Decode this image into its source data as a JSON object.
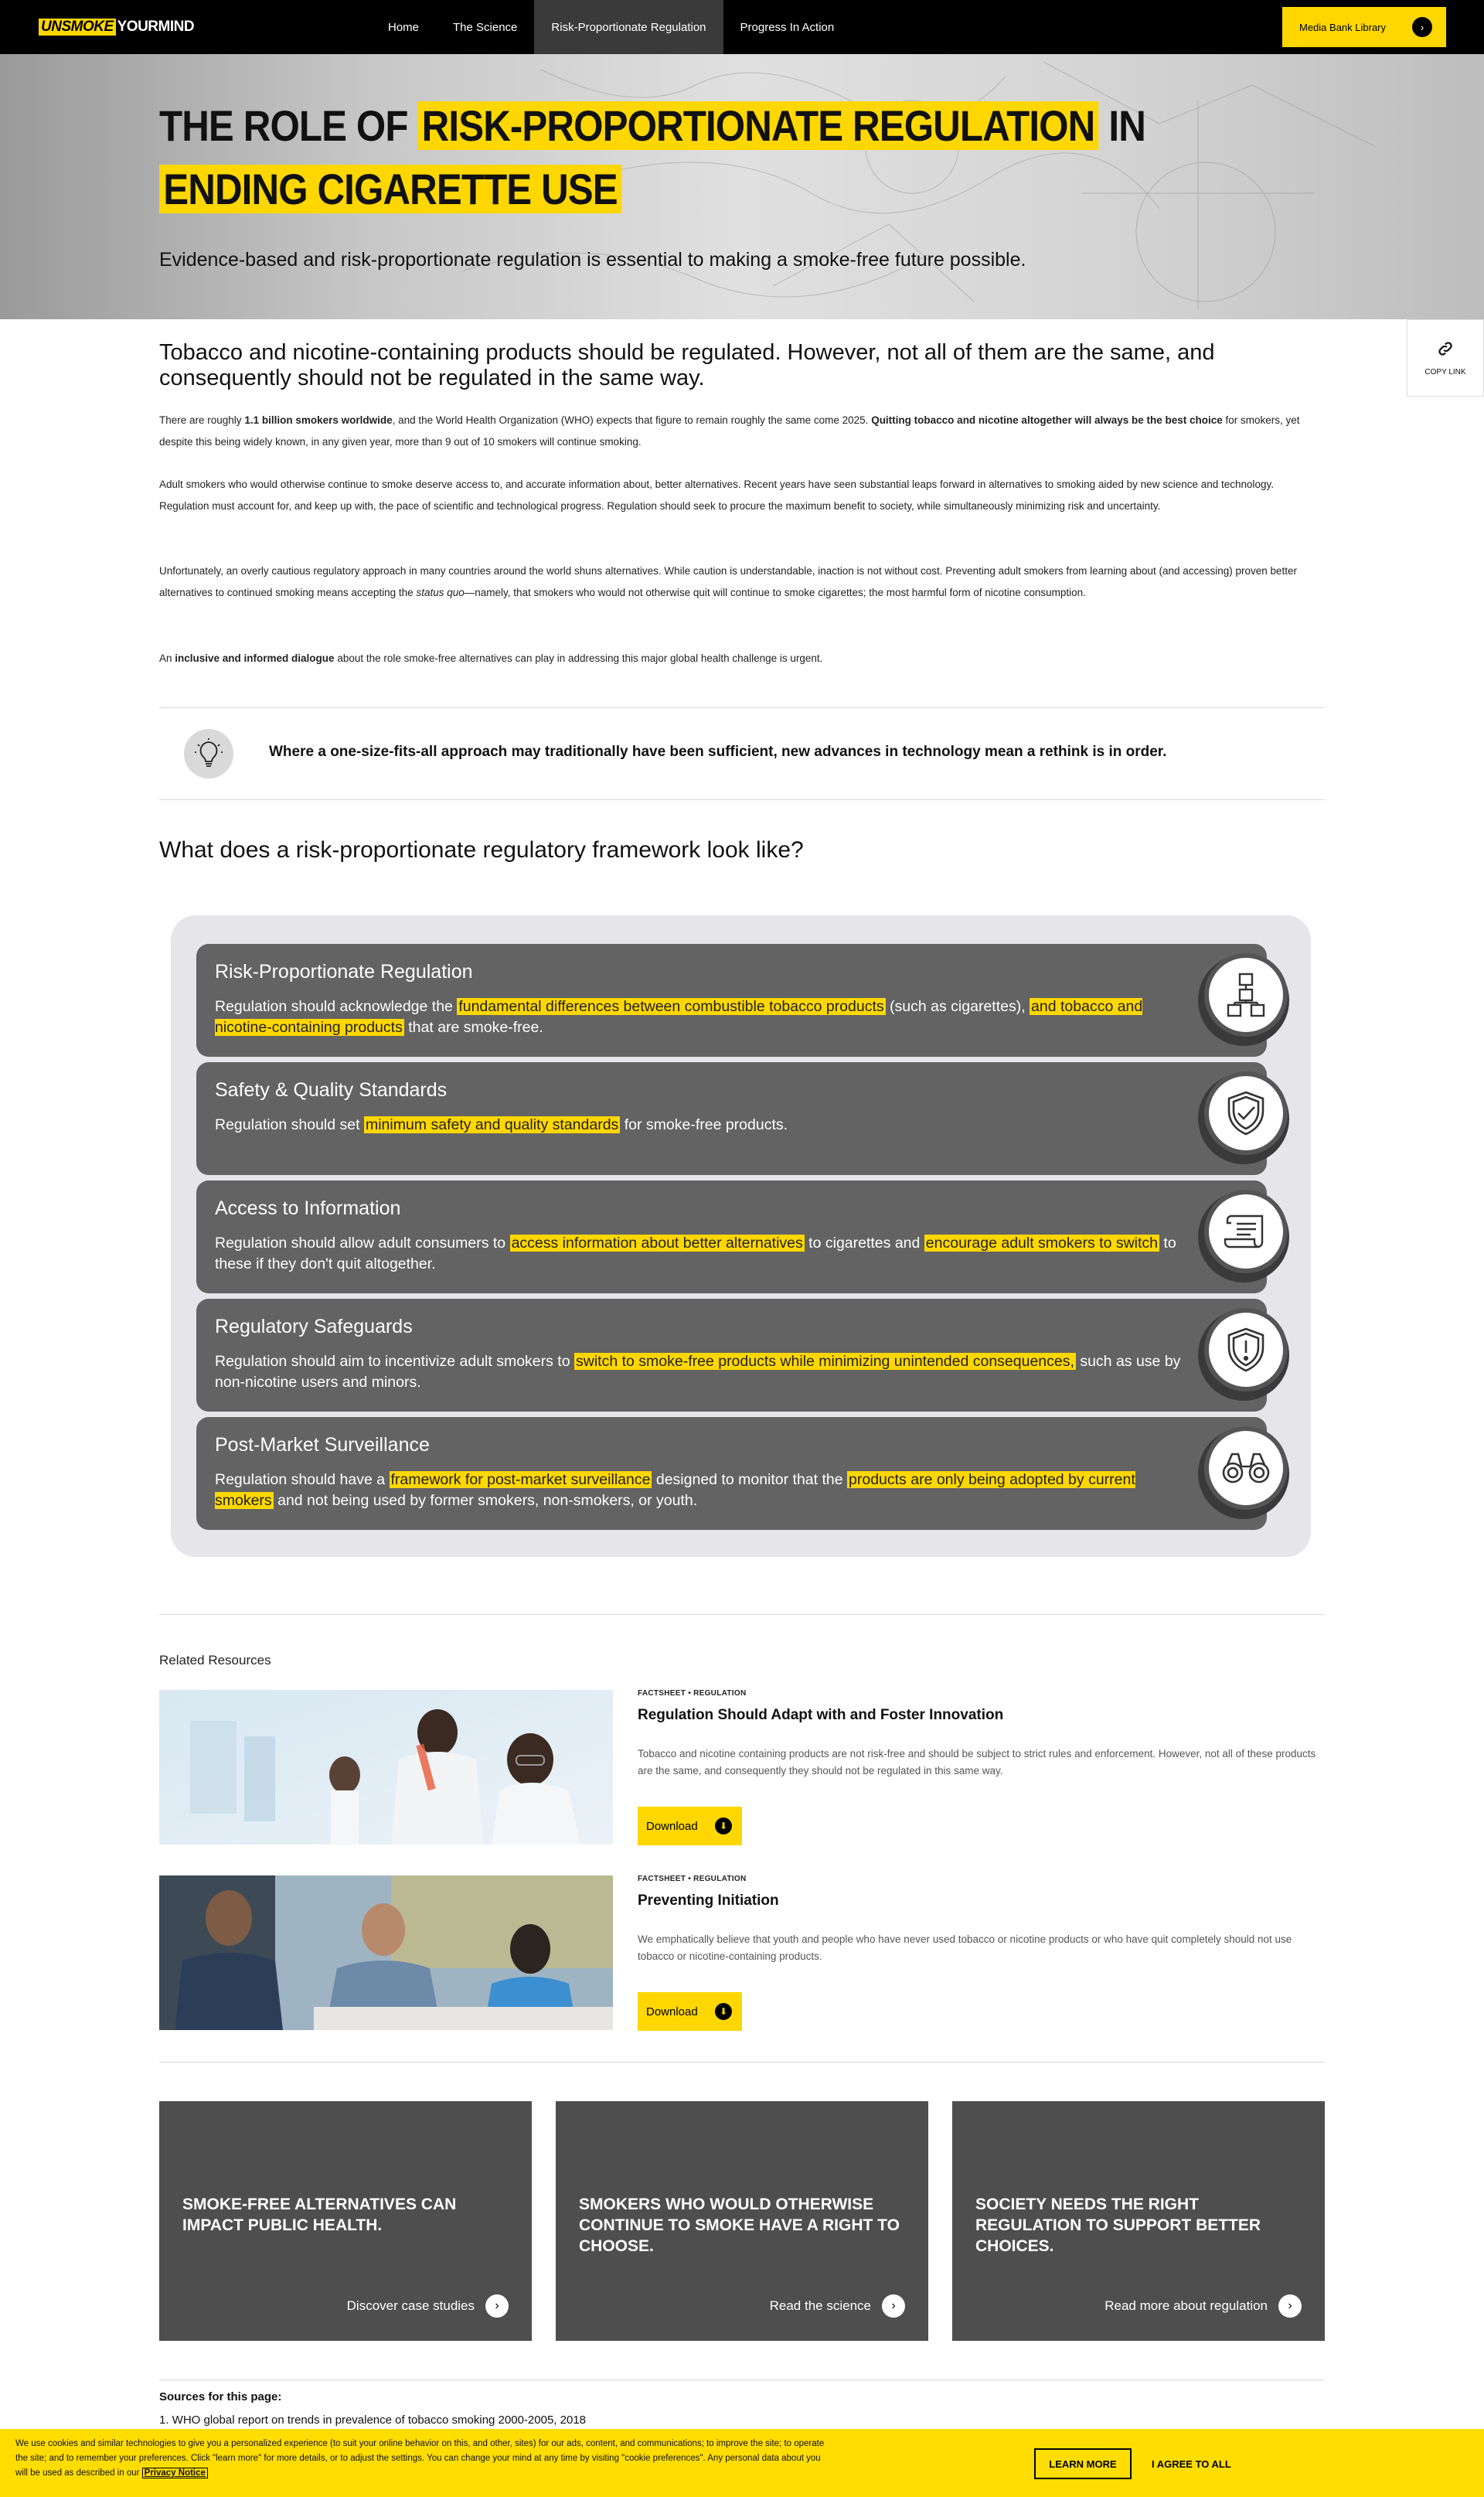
{
  "nav": {
    "logo_un": "UNSMOKE",
    "logo_rest": "YOURMIND",
    "links": [
      "Home",
      "The Science",
      "Risk-Proportionate Regulation",
      "Progress In Action"
    ],
    "active_index": 2,
    "media_button": "Media Bank Library"
  },
  "hero": {
    "title_part1": "THE ROLE OF ",
    "title_hl1": "RISK-PROPORTIONATE REGULATION",
    "title_part2": " IN ",
    "title_hl2": "ENDING CIGARETTE USE",
    "subtitle": "Evidence-based and risk-proportionate regulation is essential to making a smoke-free future possible."
  },
  "copy_link": "COPY LINK",
  "intro": {
    "heading": "Tobacco and nicotine-containing products should be regulated. However, not all of them are the same, and consequently should not be regulated in the same way.",
    "p1_a": "There are roughly ",
    "p1_b": "1.1 billion smokers worldwide",
    "p1_c": ", and the World Health Organization (WHO) expects that figure to remain roughly the same come 2025. ",
    "p1_d": "Quitting tobacco and nicotine altogether will always be the best choice",
    "p1_e": " for smokers, yet despite this being widely known, in any given year, more than 9 out of 10 smokers will continue smoking.",
    "p2": "Adult smokers who would otherwise continue to smoke deserve access to, and accurate information about, better alternatives. Recent years have seen substantial leaps forward in alternatives to smoking aided by new science and technology. Regulation must account for, and keep up with, the pace of scientific and technological progress. Regulation should seek to procure the maximum benefit to society, while simultaneously minimizing risk and uncertainty.",
    "p3_a": "Unfortunately, an overly cautious regulatory approach in many countries around the world shuns alternatives. While caution is understandable, inaction is not without cost. Preventing adult smokers from learning about (and accessing) proven better alternatives to continued smoking means accepting the ",
    "p3_b": "status quo",
    "p3_c": "—namely, that smokers who would not otherwise quit will continue to smoke cigarettes; the most harmful form of nicotine consumption.",
    "p4_a": "An ",
    "p4_b": "inclusive and informed dialogue",
    "p4_c": " about the role smoke-free alternatives can play in addressing this major global health challenge is urgent."
  },
  "callout": "Where a one-size-fits-all approach may traditionally have been sufficient, new advances in technology mean a rethink is in order.",
  "framework": {
    "heading": "What does a risk-proportionate regulatory framework look like?",
    "items": [
      {
        "title": "Risk-Proportionate Regulation",
        "icon": "hierarchy-icon",
        "d1": "Regulation should acknowledge the ",
        "h1": "fundamental differences between combustible tobacco products",
        "d2": " (such as cigarettes), ",
        "h2": "and tobacco and nicotine-containing products",
        "d3": " that are smoke-free."
      },
      {
        "title": "Safety & Quality Standards",
        "icon": "shield-check-icon",
        "d1": "Regulation should set ",
        "h1": "minimum safety and quality standards",
        "d2": " for smoke-free products.",
        "h2": "",
        "d3": ""
      },
      {
        "title": "Access to Information",
        "icon": "scroll-icon",
        "d1": "Regulation should allow adult consumers to ",
        "h1": "access information about better alternatives",
        "d2": " to cigarettes and ",
        "h2": "encourage adult smokers to switch",
        "d3": " to these if they don't quit altogether."
      },
      {
        "title": "Regulatory Safeguards",
        "icon": "shield-alert-icon",
        "d1": "Regulation should aim to incentivize adult smokers to ",
        "h1": "switch to smoke-free products while minimizing unintended consequences,",
        "d2": " such as use by non-nicotine users and minors.",
        "h2": "",
        "d3": ""
      },
      {
        "title": "Post-Market Surveillance",
        "icon": "binoculars-icon",
        "d1": "Regulation should have a ",
        "h1": "framework for post-market surveillance",
        "d2": " designed to monitor that the ",
        "h2": "products are only being adopted by current smokers",
        "d3": " and not being used by former smokers, non-smokers, or youth."
      }
    ]
  },
  "related": {
    "label": "Related Resources",
    "items": [
      {
        "meta": "FACTSHEET • REGULATION",
        "title": "Regulation Should Adapt with and Foster Innovation",
        "desc": "Tobacco and nicotine containing products are not risk-free and should be subject to strict rules and enforcement. However, not all of these products are the same, and consequently they should not be regulated in this same way.",
        "button": "Download"
      },
      {
        "meta": "FACTSHEET • REGULATION",
        "title": "Preventing Initiation",
        "desc": "We emphatically believe that youth and people who have never used tobacco or nicotine products or who have quit completely should not use tobacco or nicotine-containing products.",
        "button": "Download"
      }
    ]
  },
  "tiles": [
    {
      "title": "SMOKE-FREE ALTERNATIVES CAN IMPACT PUBLIC HEALTH.",
      "link": "Discover case studies"
    },
    {
      "title": "SMOKERS WHO WOULD OTHERWISE CONTINUE TO SMOKE HAVE A RIGHT TO CHOOSE.",
      "link": "Read the science"
    },
    {
      "title": "SOCIETY NEEDS THE RIGHT REGULATION TO SUPPORT BETTER CHOICES.",
      "link": "Read more about regulation"
    }
  ],
  "sources": {
    "heading": "Sources for this page:",
    "items": [
      "1. WHO global report on trends in prevalence of tobacco smoking 2000-2005, 2018"
    ]
  },
  "cookie": {
    "text": "We use cookies and similar technologies to give you a personalized experience (to suit your online behavior on this, and other, sites) for our ads, content, and communications; to improve the site; to operate the site; and to remember your preferences. Click \"learn more\" for more details, or to adjust the settings. You can change your mind at any time by visiting \"cookie preferences\". Any personal data about you will be used as described in our ",
    "privacy": "Privacy Notice",
    "learn_more": "LEARN MORE",
    "agree": "I AGREE TO ALL"
  },
  "colors": {
    "accent": "#ffd700",
    "nav_bg": "#000000",
    "card_bg": "#636363",
    "tile_bg": "#4f4e4e"
  }
}
